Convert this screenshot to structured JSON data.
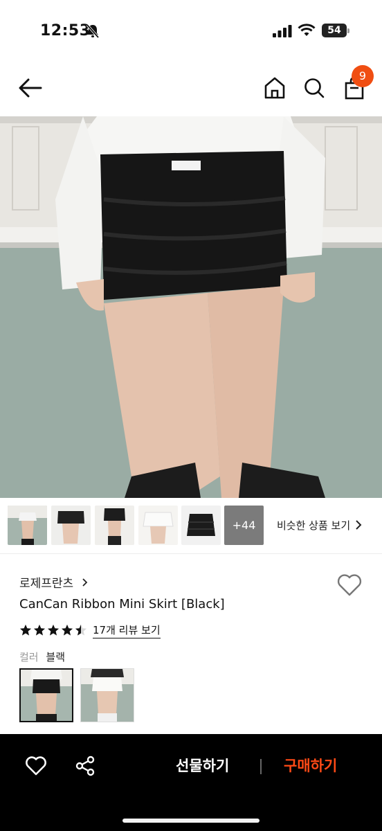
{
  "status_bar": {
    "time": "12:53",
    "battery": "54"
  },
  "header": {
    "cart_count": "9"
  },
  "thumbnails": {
    "more_label": "+44",
    "similar_label": "비슷한 상품 보기"
  },
  "product": {
    "brand": "로제프란츠",
    "title": "CanCan Ribbon Mini Skirt [Black]",
    "rating": 4.5,
    "review_link": "17개 리뷰 보기",
    "color_label": "컬러",
    "color_value": "블랙"
  },
  "bottom_bar": {
    "gift_label": "선물하기",
    "buy_label": "구매하기"
  },
  "colors": {
    "accent": "#f04e12",
    "buy_text": "#ff4a16",
    "bar_bg": "#000000"
  },
  "icons": [
    "bell-slash-icon",
    "signal-icon",
    "wifi-icon",
    "back-arrow-icon",
    "home-icon",
    "search-icon",
    "shopping-bag-icon",
    "chevron-right-icon",
    "heart-icon",
    "star-icon",
    "share-icon"
  ]
}
